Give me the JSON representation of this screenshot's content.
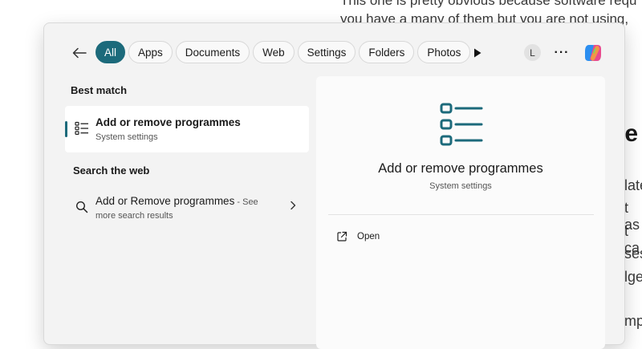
{
  "background": {
    "line1": "This one is pretty obvious because software requ",
    "line2": "you have a many of them but you are not using,",
    "heading_fragment": "le",
    "fragments": [
      "late",
      "t as",
      "t ca",
      "ses",
      "lge",
      "mpe"
    ]
  },
  "search": {
    "back_icon": "arrow-left-icon",
    "chips": [
      "All",
      "Apps",
      "Documents",
      "Web",
      "Settings",
      "Folders",
      "Photos"
    ],
    "active_chip": "All",
    "avatar_letter": "L",
    "more_label": "···",
    "accent_color": "#1c6a7b"
  },
  "results": {
    "best_match_label": "Best match",
    "best_match": {
      "title": "Add or remove programmes",
      "subtitle": "System settings",
      "icon": "list-icon"
    },
    "search_web_label": "Search the web",
    "web_result": {
      "title": "Add or Remove programmes",
      "title_suffix": " - See",
      "subtitle": "more search results",
      "icon": "search-icon"
    }
  },
  "detail": {
    "title": "Add or remove programmes",
    "subtitle": "System settings",
    "icon": "list-icon",
    "actions": [
      {
        "label": "Open",
        "icon": "open-external-icon"
      }
    ]
  }
}
